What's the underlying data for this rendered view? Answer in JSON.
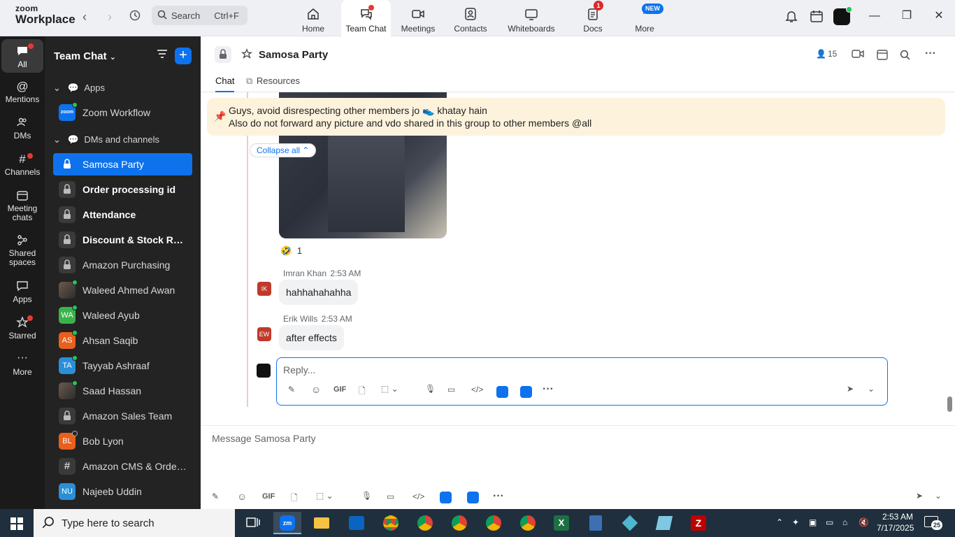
{
  "topbar": {
    "brand_line1": "zoom",
    "brand_line2": "Workplace",
    "search_label": "Search",
    "search_shortcut": "Ctrl+F",
    "tabs": [
      {
        "label": "Home",
        "icon": "home-icon"
      },
      {
        "label": "Team Chat",
        "icon": "team-chat-icon"
      },
      {
        "label": "Meetings",
        "icon": "meetings-icon"
      },
      {
        "label": "Contacts",
        "icon": "contacts-icon"
      },
      {
        "label": "Whiteboards",
        "icon": "whiteboards-icon"
      },
      {
        "label": "Docs",
        "icon": "docs-icon",
        "badge": "1"
      },
      {
        "label": "More",
        "icon": "more-icon",
        "badge": "NEW"
      }
    ]
  },
  "rail": [
    {
      "label": "All",
      "icon": "chat-bubble-icon"
    },
    {
      "label": "Mentions",
      "icon": "at-icon"
    },
    {
      "label": "DMs",
      "icon": "people-icon"
    },
    {
      "label": "Channels",
      "icon": "hash-icon"
    },
    {
      "label": "Meeting chats",
      "icon": "calendar-icon"
    },
    {
      "label": "Shared spaces",
      "icon": "shared-spaces-icon"
    },
    {
      "label": "Apps",
      "icon": "apps-icon"
    },
    {
      "label": "Starred",
      "icon": "star-icon"
    },
    {
      "label": "More",
      "icon": "ellipsis-icon"
    }
  ],
  "sidebar": {
    "title": "Team Chat",
    "sections": {
      "apps": "Apps",
      "dms": "DMs and channels"
    },
    "apps": [
      {
        "label": "Zoom Workflow",
        "avatar": "zoom"
      }
    ],
    "items": [
      {
        "label": "Samosa Party",
        "type": "lock"
      },
      {
        "label": "Order processing id",
        "type": "lock"
      },
      {
        "label": "Attendance",
        "type": "lock"
      },
      {
        "label": "Discount & Stock Res...",
        "type": "lock"
      },
      {
        "label": "Amazon Purchasing",
        "type": "lock"
      },
      {
        "label": "Waleed Ahmed Awan",
        "type": "photo"
      },
      {
        "label": "Waleed Ayub",
        "type": "initials",
        "initials": "WA",
        "color": "#3bb34a"
      },
      {
        "label": "Ahsan Saqib",
        "type": "initials",
        "initials": "AS",
        "color": "#e8601c"
      },
      {
        "label": "Tayyab Ashraaf",
        "type": "initials",
        "initials": "TA",
        "color": "#2a8fd6"
      },
      {
        "label": "Saad Hassan",
        "type": "photo"
      },
      {
        "label": "Amazon Sales Team",
        "type": "lock"
      },
      {
        "label": "Bob Lyon",
        "type": "initials",
        "initials": "BL",
        "color": "#e8601c"
      },
      {
        "label": "Amazon CMS & OrderA...",
        "type": "hash"
      },
      {
        "label": "Najeeb Uddin",
        "type": "initials",
        "initials": "NU",
        "color": "#2a8fd6"
      }
    ]
  },
  "channel": {
    "name": "Samosa Party",
    "member_count": "15",
    "tabs": [
      "Chat",
      "Resources"
    ],
    "pinned_line1": "Guys, avoid disrespecting other members jo 👟 khatay hain",
    "pinned_line2": "Also do not forward any picture and vdo shared in this group to other members @all",
    "collapse_label": "Collapse all",
    "reaction": {
      "emoji": "🤣",
      "count": "1"
    },
    "messages": [
      {
        "author": "Imran Khan",
        "time": "2:53 AM",
        "text": "hahhahahahha",
        "initials": "IK"
      },
      {
        "author": "Erik Wills",
        "time": "2:53 AM",
        "text": "after effects",
        "initials": "EW"
      }
    ],
    "reply_placeholder": "Reply...",
    "composer_placeholder": "Message Samosa Party",
    "toolbar": {
      "gif": "GIF"
    }
  },
  "taskbar": {
    "search_placeholder": "Type here to search",
    "time": "2:53 AM",
    "date": "7/17/2025",
    "notifications": "25"
  },
  "colors": {
    "accent": "#0e72ed",
    "pinned_bg": "#fdf3dd",
    "sidebar_bg": "#232323",
    "rail_bg": "#1a1a1a"
  }
}
